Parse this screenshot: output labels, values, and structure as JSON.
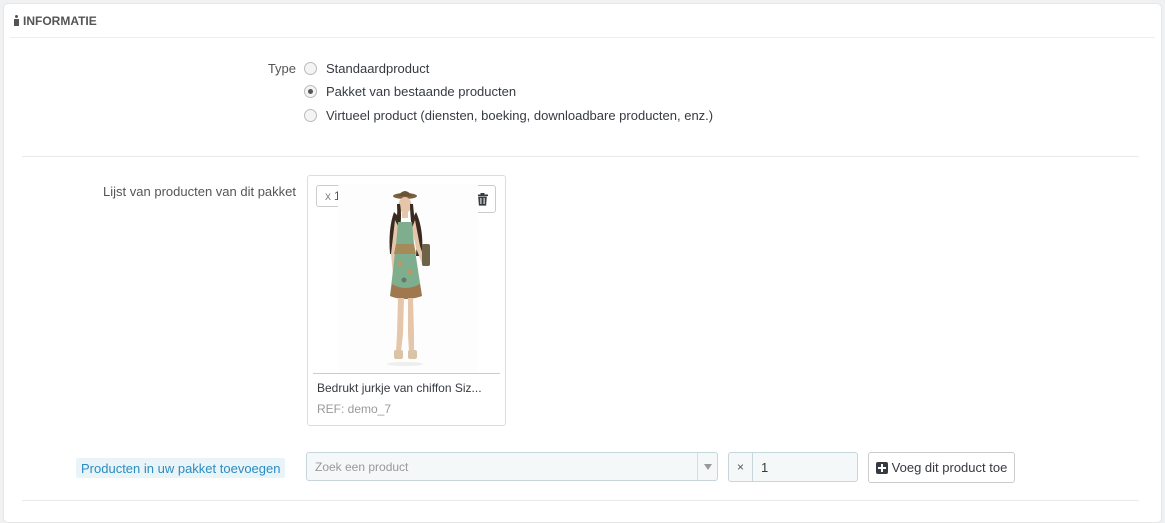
{
  "panel": {
    "heading": "INFORMATIE"
  },
  "type_field": {
    "label": "Type",
    "options": [
      {
        "label": "Standaardproduct",
        "checked": false
      },
      {
        "label": "Pakket van bestaande producten",
        "checked": true
      },
      {
        "label": "Virtueel product (diensten, boeking, downloadbare producten, enz.)",
        "checked": false
      }
    ]
  },
  "pack_list": {
    "label": "Lijst van producten van dit pakket",
    "items": [
      {
        "qty_prefix": "x",
        "qty": "1",
        "name": "Bedrukt jurkje van chiffon Siz...",
        "ref": "REF: demo_7",
        "delete_icon": "trash-icon"
      }
    ]
  },
  "add_section": {
    "label": "Producten in uw pakket toevoegen",
    "search_placeholder": "Zoek een product",
    "qty_addon": "×",
    "qty_value": "1",
    "add_button_label": "Voeg dit product toe",
    "add_button_icon": "plus-square-icon"
  },
  "colors": {
    "accent": "#2c8bbf",
    "accent_bg": "#e9f4f9",
    "text": "#363a41",
    "border": "#dddddd"
  }
}
